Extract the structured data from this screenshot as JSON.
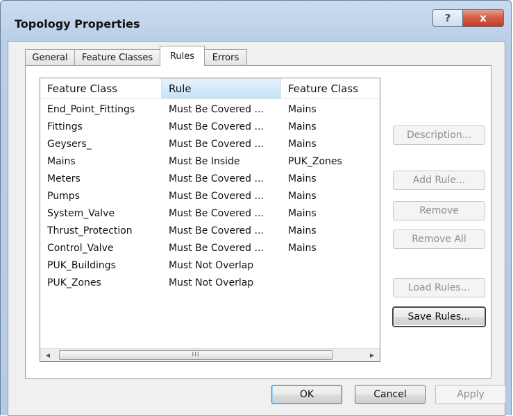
{
  "window": {
    "title": "Topology Properties",
    "help_glyph": "?",
    "close_glyph": "x"
  },
  "tabs": [
    {
      "label": "General"
    },
    {
      "label": "Feature Classes"
    },
    {
      "label": "Rules"
    },
    {
      "label": "Errors"
    }
  ],
  "active_tab": "Rules",
  "rules_table": {
    "columns": [
      "Feature Class",
      "Rule",
      "Feature Class"
    ],
    "rows": [
      [
        "End_Point_Fittings",
        "Must Be Covered ...",
        "Mains"
      ],
      [
        "Fittings",
        "Must Be Covered ...",
        "Mains"
      ],
      [
        "Geysers_",
        "Must Be Covered ...",
        "Mains"
      ],
      [
        "Mains",
        "Must Be Inside",
        "PUK_Zones"
      ],
      [
        "Meters",
        "Must Be Covered ...",
        "Mains"
      ],
      [
        "Pumps",
        "Must Be Covered ...",
        "Mains"
      ],
      [
        "System_Valve",
        "Must Be Covered ...",
        "Mains"
      ],
      [
        "Thrust_Protection",
        "Must Be Covered ...",
        "Mains"
      ],
      [
        "Control_Valve",
        "Must Be Covered ...",
        "Mains"
      ],
      [
        "PUK_Buildings",
        "Must Not Overlap",
        ""
      ],
      [
        "PUK_Zones",
        "Must Not Overlap",
        ""
      ]
    ],
    "scrollbar": {
      "left_arrow": "◀",
      "right_arrow": "▶",
      "grip": "III"
    }
  },
  "side_buttons": {
    "description": "Description...",
    "add_rule": "Add Rule...",
    "remove": "Remove",
    "remove_all": "Remove All",
    "load_rules": "Load Rules...",
    "save_rules": "Save Rules..."
  },
  "bottom_buttons": {
    "ok": "OK",
    "cancel": "Cancel",
    "apply": "Apply"
  },
  "colors": {
    "frame": "#b9cfe7",
    "close_button": "#c94a32",
    "sorted_header": "#c4e3f6"
  }
}
